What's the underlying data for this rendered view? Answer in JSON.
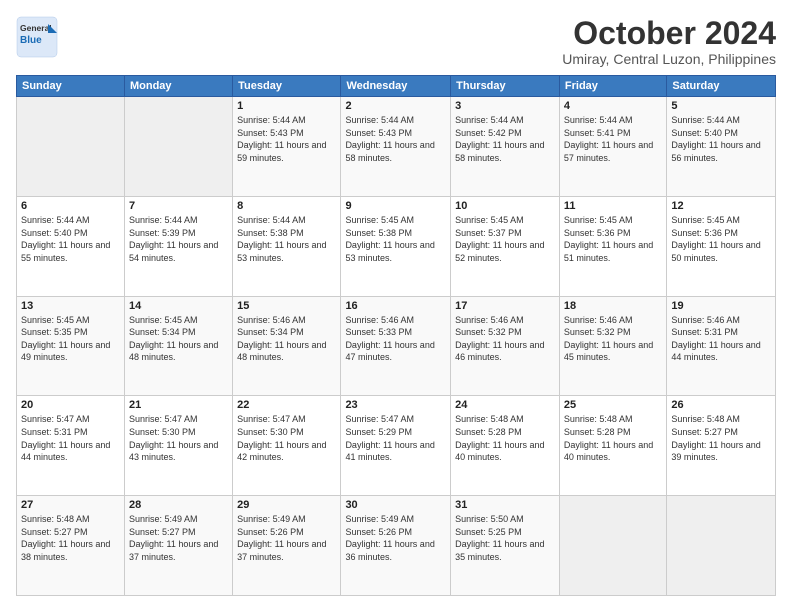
{
  "logo": {
    "general": "General",
    "blue": "Blue"
  },
  "header": {
    "month": "October 2024",
    "location": "Umiray, Central Luzon, Philippines"
  },
  "weekdays": [
    "Sunday",
    "Monday",
    "Tuesday",
    "Wednesday",
    "Thursday",
    "Friday",
    "Saturday"
  ],
  "weeks": [
    [
      {
        "day": "",
        "info": ""
      },
      {
        "day": "",
        "info": ""
      },
      {
        "day": "1",
        "info": "Sunrise: 5:44 AM\nSunset: 5:43 PM\nDaylight: 11 hours and 59 minutes."
      },
      {
        "day": "2",
        "info": "Sunrise: 5:44 AM\nSunset: 5:43 PM\nDaylight: 11 hours and 58 minutes."
      },
      {
        "day": "3",
        "info": "Sunrise: 5:44 AM\nSunset: 5:42 PM\nDaylight: 11 hours and 58 minutes."
      },
      {
        "day": "4",
        "info": "Sunrise: 5:44 AM\nSunset: 5:41 PM\nDaylight: 11 hours and 57 minutes."
      },
      {
        "day": "5",
        "info": "Sunrise: 5:44 AM\nSunset: 5:40 PM\nDaylight: 11 hours and 56 minutes."
      }
    ],
    [
      {
        "day": "6",
        "info": "Sunrise: 5:44 AM\nSunset: 5:40 PM\nDaylight: 11 hours and 55 minutes."
      },
      {
        "day": "7",
        "info": "Sunrise: 5:44 AM\nSunset: 5:39 PM\nDaylight: 11 hours and 54 minutes."
      },
      {
        "day": "8",
        "info": "Sunrise: 5:44 AM\nSunset: 5:38 PM\nDaylight: 11 hours and 53 minutes."
      },
      {
        "day": "9",
        "info": "Sunrise: 5:45 AM\nSunset: 5:38 PM\nDaylight: 11 hours and 53 minutes."
      },
      {
        "day": "10",
        "info": "Sunrise: 5:45 AM\nSunset: 5:37 PM\nDaylight: 11 hours and 52 minutes."
      },
      {
        "day": "11",
        "info": "Sunrise: 5:45 AM\nSunset: 5:36 PM\nDaylight: 11 hours and 51 minutes."
      },
      {
        "day": "12",
        "info": "Sunrise: 5:45 AM\nSunset: 5:36 PM\nDaylight: 11 hours and 50 minutes."
      }
    ],
    [
      {
        "day": "13",
        "info": "Sunrise: 5:45 AM\nSunset: 5:35 PM\nDaylight: 11 hours and 49 minutes."
      },
      {
        "day": "14",
        "info": "Sunrise: 5:45 AM\nSunset: 5:34 PM\nDaylight: 11 hours and 48 minutes."
      },
      {
        "day": "15",
        "info": "Sunrise: 5:46 AM\nSunset: 5:34 PM\nDaylight: 11 hours and 48 minutes."
      },
      {
        "day": "16",
        "info": "Sunrise: 5:46 AM\nSunset: 5:33 PM\nDaylight: 11 hours and 47 minutes."
      },
      {
        "day": "17",
        "info": "Sunrise: 5:46 AM\nSunset: 5:32 PM\nDaylight: 11 hours and 46 minutes."
      },
      {
        "day": "18",
        "info": "Sunrise: 5:46 AM\nSunset: 5:32 PM\nDaylight: 11 hours and 45 minutes."
      },
      {
        "day": "19",
        "info": "Sunrise: 5:46 AM\nSunset: 5:31 PM\nDaylight: 11 hours and 44 minutes."
      }
    ],
    [
      {
        "day": "20",
        "info": "Sunrise: 5:47 AM\nSunset: 5:31 PM\nDaylight: 11 hours and 44 minutes."
      },
      {
        "day": "21",
        "info": "Sunrise: 5:47 AM\nSunset: 5:30 PM\nDaylight: 11 hours and 43 minutes."
      },
      {
        "day": "22",
        "info": "Sunrise: 5:47 AM\nSunset: 5:30 PM\nDaylight: 11 hours and 42 minutes."
      },
      {
        "day": "23",
        "info": "Sunrise: 5:47 AM\nSunset: 5:29 PM\nDaylight: 11 hours and 41 minutes."
      },
      {
        "day": "24",
        "info": "Sunrise: 5:48 AM\nSunset: 5:28 PM\nDaylight: 11 hours and 40 minutes."
      },
      {
        "day": "25",
        "info": "Sunrise: 5:48 AM\nSunset: 5:28 PM\nDaylight: 11 hours and 40 minutes."
      },
      {
        "day": "26",
        "info": "Sunrise: 5:48 AM\nSunset: 5:27 PM\nDaylight: 11 hours and 39 minutes."
      }
    ],
    [
      {
        "day": "27",
        "info": "Sunrise: 5:48 AM\nSunset: 5:27 PM\nDaylight: 11 hours and 38 minutes."
      },
      {
        "day": "28",
        "info": "Sunrise: 5:49 AM\nSunset: 5:27 PM\nDaylight: 11 hours and 37 minutes."
      },
      {
        "day": "29",
        "info": "Sunrise: 5:49 AM\nSunset: 5:26 PM\nDaylight: 11 hours and 37 minutes."
      },
      {
        "day": "30",
        "info": "Sunrise: 5:49 AM\nSunset: 5:26 PM\nDaylight: 11 hours and 36 minutes."
      },
      {
        "day": "31",
        "info": "Sunrise: 5:50 AM\nSunset: 5:25 PM\nDaylight: 11 hours and 35 minutes."
      },
      {
        "day": "",
        "info": ""
      },
      {
        "day": "",
        "info": ""
      }
    ]
  ]
}
